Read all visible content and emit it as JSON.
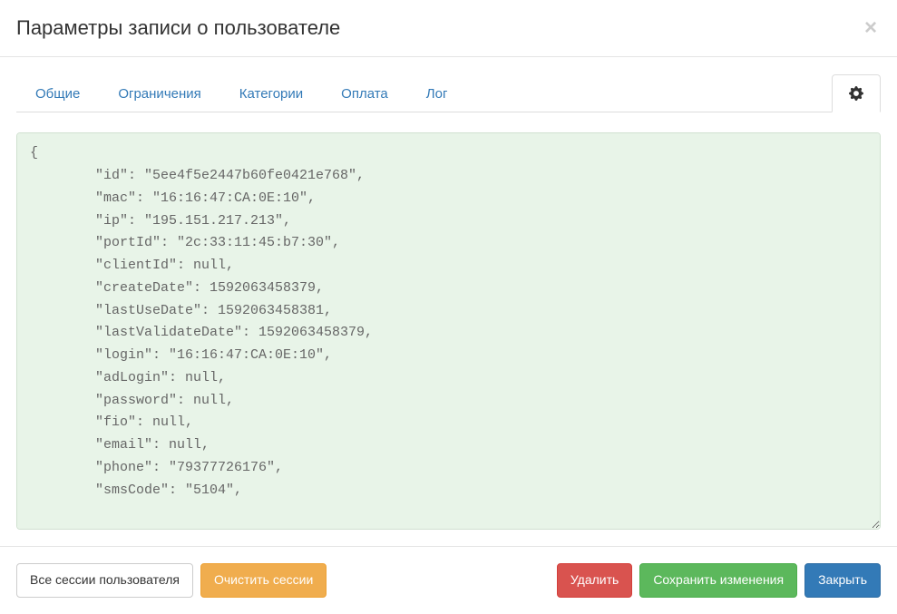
{
  "header": {
    "title": "Параметры записи о пользователе"
  },
  "tabs": {
    "general": "Общие",
    "restrictions": "Ограничения",
    "categories": "Категории",
    "payment": "Оплата",
    "log": "Лог"
  },
  "json_content": "{\n        \"id\": \"5ee4f5e2447b60fe0421e768\",\n        \"mac\": \"16:16:47:CA:0E:10\",\n        \"ip\": \"195.151.217.213\",\n        \"portId\": \"2c:33:11:45:b7:30\",\n        \"clientId\": null,\n        \"createDate\": 1592063458379,\n        \"lastUseDate\": 1592063458381,\n        \"lastValidateDate\": 1592063458379,\n        \"login\": \"16:16:47:CA:0E:10\",\n        \"adLogin\": null,\n        \"password\": null,\n        \"fio\": null,\n        \"email\": null,\n        \"phone\": \"79377726176\",\n        \"smsCode\": \"5104\",\n",
  "footer": {
    "all_sessions": "Все сессии пользователя",
    "clear_sessions": "Очистить сессии",
    "delete": "Удалить",
    "save": "Сохранить изменения",
    "close": "Закрыть"
  }
}
